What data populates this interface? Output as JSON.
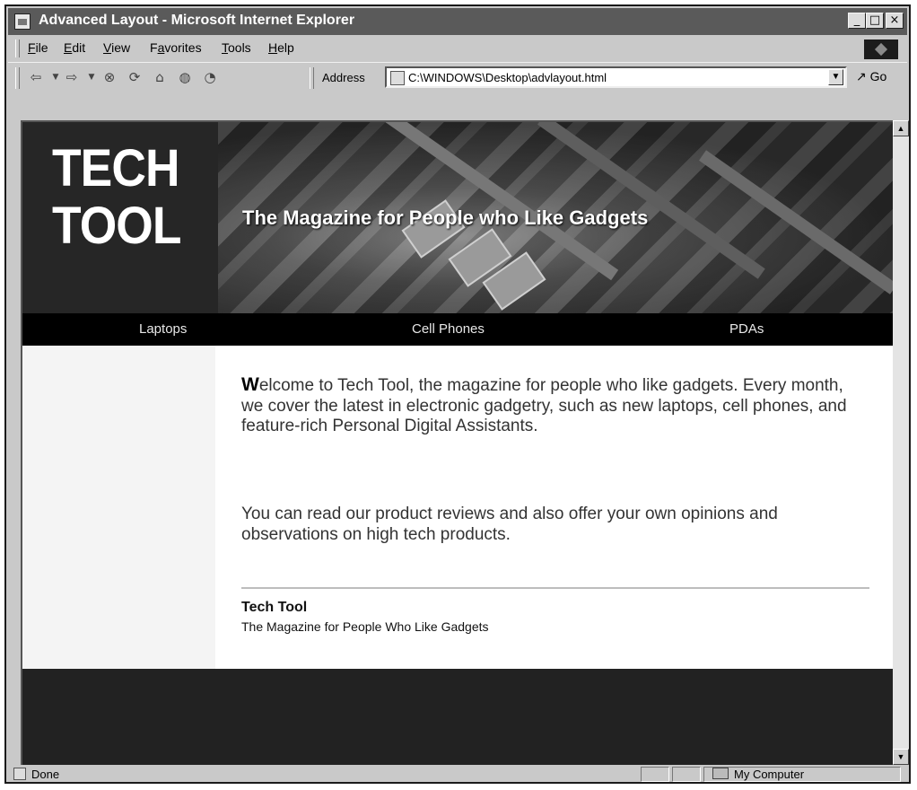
{
  "window": {
    "title": "Advanced Layout - Microsoft Internet Explorer",
    "min_glyph": "_",
    "max_glyph": "□",
    "close_glyph": "×"
  },
  "menubar": {
    "items": [
      {
        "label": "File",
        "key": "F",
        "rest": "ile"
      },
      {
        "label": "Edit",
        "key": "E",
        "rest": "dit"
      },
      {
        "label": "View",
        "key": "V",
        "rest": "iew"
      },
      {
        "label": "Favorites",
        "pre": "F",
        "key": "a",
        "rest": "vorites"
      },
      {
        "label": "Tools",
        "key": "T",
        "rest": "ools"
      },
      {
        "label": "Help",
        "key": "H",
        "rest": "elp"
      }
    ]
  },
  "toolbar": {
    "address_label": "Address",
    "address_value": "C:\\WINDOWS\\Desktop\\advlayout.html",
    "go_label": "Go"
  },
  "page": {
    "logo_line1": "TECH",
    "logo_line2": "TOOL",
    "tagline": "The Magazine for People who Like Gadgets",
    "nav": [
      "Laptops",
      "Cell Phones",
      "PDAs"
    ],
    "intro_dropcap": "W",
    "intro_rest": "elcome to Tech Tool, the magazine for people who like gadgets. Every month, we cover the latest in electronic gadgetry, such as new laptops, cell phones, and feature-rich Personal Digital Assistants.",
    "paragraph2": "You can read our product reviews and also offer your own opinions and observations on high tech products.",
    "footer_title": "Tech Tool",
    "footer_subtitle": "The Magazine for People Who Like Gadgets"
  },
  "statusbar": {
    "status": "Done",
    "zone": "My Computer"
  }
}
